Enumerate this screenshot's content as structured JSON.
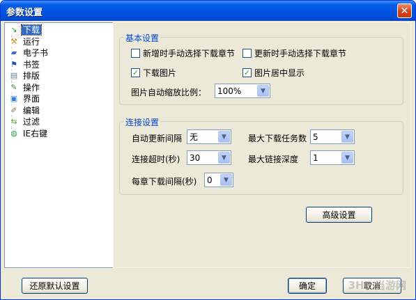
{
  "window": {
    "title": "参数设置",
    "close_label": "✕"
  },
  "tree": {
    "items": [
      {
        "label": "下载",
        "icon": "download-arrow-icon",
        "color": "#2e9b2e",
        "glyph": "↘"
      },
      {
        "label": "运行",
        "icon": "hammer-icon",
        "color": "#c98a1a",
        "glyph": "⚒"
      },
      {
        "label": "电子书",
        "icon": "book-icon",
        "color": "#3a6fc4",
        "glyph": "▰"
      },
      {
        "label": "书签",
        "icon": "flag-icon",
        "color": "#1f4fb8",
        "glyph": "⚑"
      },
      {
        "label": "排版",
        "icon": "document-icon",
        "color": "#6c7c99",
        "glyph": "▤"
      },
      {
        "label": "操作",
        "icon": "edit-check-icon",
        "color": "#3a8a3a",
        "glyph": "✎"
      },
      {
        "label": "界面",
        "icon": "window-icon",
        "color": "#2d7ad0",
        "glyph": "▣"
      },
      {
        "label": "编辑",
        "icon": "pencil-icon",
        "color": "#8a6d3b",
        "glyph": "✐"
      },
      {
        "label": "过滤",
        "icon": "filter-icon",
        "color": "#5d9b2a",
        "glyph": "⇆"
      },
      {
        "label": "IE右键",
        "icon": "globe-icon",
        "color": "#2e9b4e",
        "glyph": "◍"
      }
    ]
  },
  "basic": {
    "title": "基本设置",
    "cb_new_manual": {
      "label": "新增时手动选择下载章节",
      "checked": false
    },
    "cb_update_manual": {
      "label": "更新时手动选择下载章节",
      "checked": false
    },
    "cb_download_images": {
      "label": "下载图片",
      "checked": true
    },
    "cb_center_images": {
      "label": "图片居中显示",
      "checked": true
    },
    "scale_label": "图片自动缩放比例：",
    "scale_value": "100%"
  },
  "connection": {
    "title": "连接设置",
    "auto_update_label": "自动更新间隔",
    "auto_update_value": "无",
    "max_tasks_label": "最大下载任务数",
    "max_tasks_value": "5",
    "timeout_label": "连接超时(秒)",
    "timeout_value": "30",
    "max_depth_label": "最大链接深度",
    "max_depth_value": "1",
    "chapter_interval_label": "每章下载间隔(秒)",
    "chapter_interval_value": "0"
  },
  "buttons": {
    "advanced": "高级设置",
    "restore_defaults": "还原默认设置",
    "ok": "确定",
    "cancel": "取消"
  },
  "watermark": "3HE 当游网"
}
